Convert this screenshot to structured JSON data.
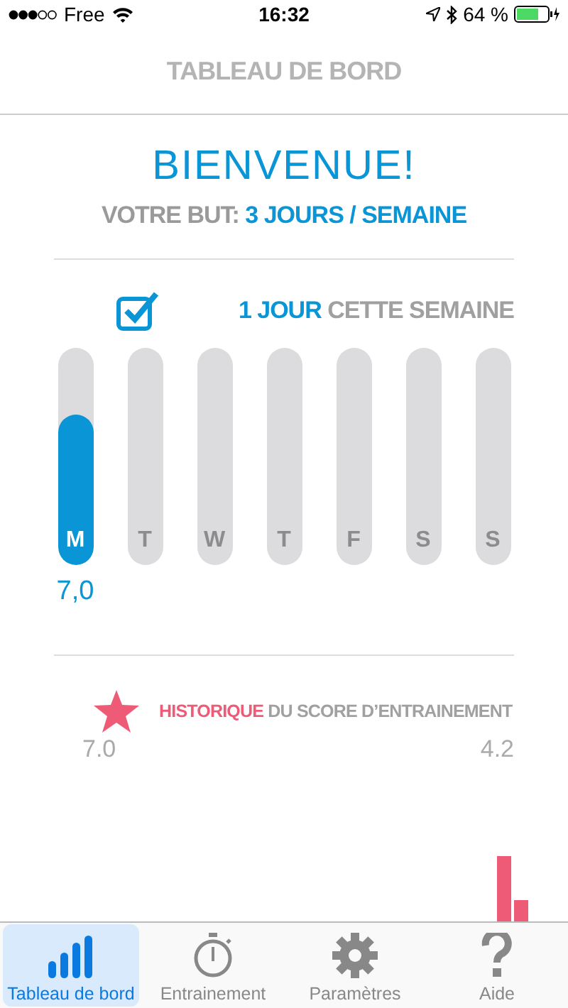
{
  "status_bar": {
    "carrier": "Free",
    "time": "16:32",
    "battery": "64 %"
  },
  "nav": {
    "title": "TABLEAU DE BORD"
  },
  "welcome": "BIENVENUE!",
  "goal": {
    "label": "VOTRE BUT:",
    "value": "3 JOURS / SEMAINE"
  },
  "week": {
    "checked": true,
    "count": "1 JOUR",
    "suffix": "CETTE SEMAINE",
    "days": [
      {
        "label": "M",
        "level": 0.69,
        "value": "7,0"
      },
      {
        "label": "T"
      },
      {
        "label": "W"
      },
      {
        "label": "T"
      },
      {
        "label": "F"
      },
      {
        "label": "S"
      },
      {
        "label": "S"
      }
    ]
  },
  "history": {
    "title": "HISTORIQUE",
    "subtitle": "DU SCORE D’ENTRAINEMENT",
    "first": "7.0",
    "last": "4.2"
  },
  "tabs": [
    {
      "kind": "dashboard",
      "label": "Tableau de bord",
      "selected": true
    },
    {
      "kind": "timer",
      "label": "Entrainement",
      "selected": false
    },
    {
      "kind": "settings",
      "label": "Paramètres",
      "selected": false
    },
    {
      "kind": "help",
      "label": "Aide",
      "selected": false
    }
  ]
}
